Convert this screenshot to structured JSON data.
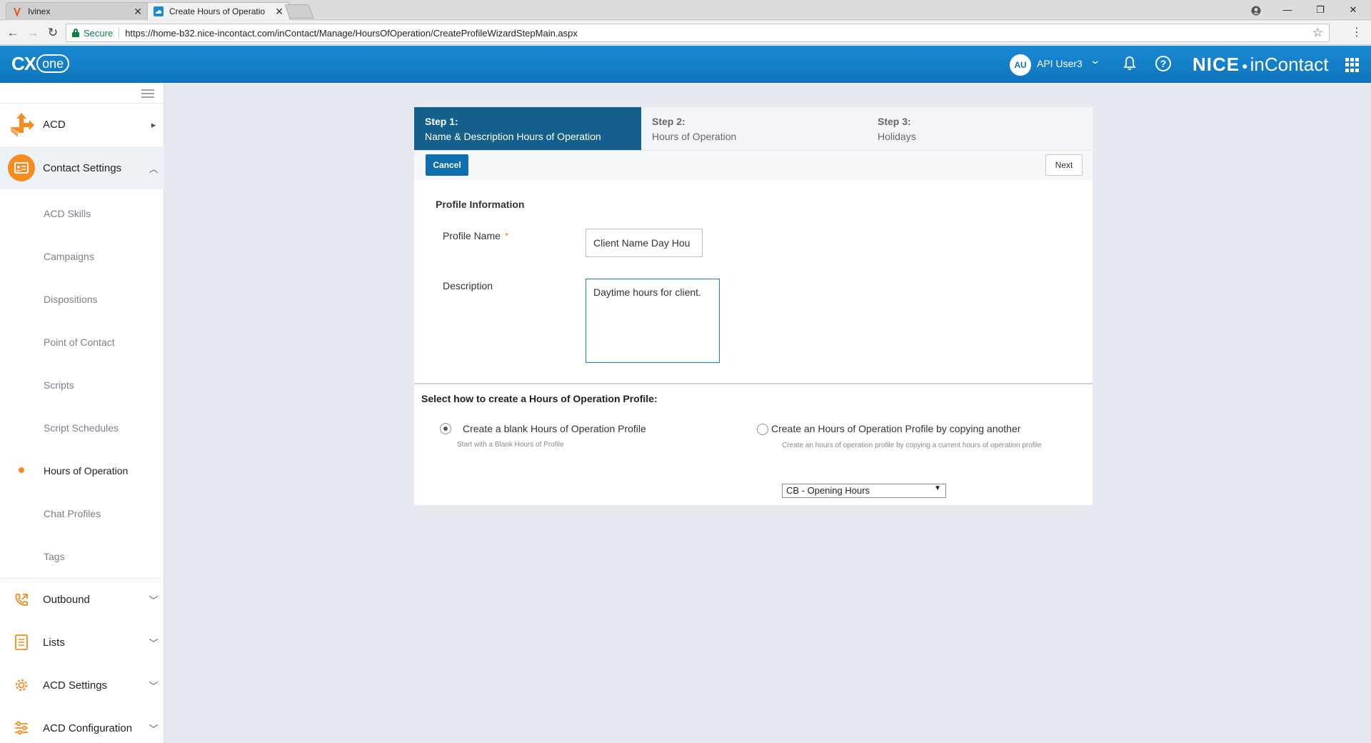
{
  "browser": {
    "tabs": [
      {
        "title": "Ivinex"
      },
      {
        "title": "Create Hours of Operatio"
      }
    ],
    "secure_label": "Secure",
    "url": "https://home-b32.nice-incontact.com/inContact/Manage/HoursOfOperation/CreateProfileWizardStepMain.aspx"
  },
  "header": {
    "logo_cx": "CX",
    "logo_one": "one",
    "user_initials": "AU",
    "user_name": "API User3",
    "brand_nice": "NICE",
    "brand_incontact": "inContact"
  },
  "sidebar": {
    "groups": [
      {
        "label": "ACD",
        "icon": "acd-arrows-icon"
      },
      {
        "label": "Contact Settings",
        "icon": "contact-card-icon"
      },
      {
        "label": "Outbound",
        "icon": "phone-outbound-icon"
      },
      {
        "label": "Lists",
        "icon": "list-icon"
      },
      {
        "label": "ACD Settings",
        "icon": "gear-icon"
      },
      {
        "label": "ACD Configuration",
        "icon": "sliders-icon"
      }
    ],
    "sub_items": [
      "ACD Skills",
      "Campaigns",
      "Dispositions",
      "Point of Contact",
      "Scripts",
      "Script Schedules",
      "Hours of Operation",
      "Chat Profiles",
      "Tags"
    ],
    "current_item": "Hours of Operation"
  },
  "wizard": {
    "steps": [
      {
        "number": "Step 1:",
        "label": "Name & Description Hours of Operation"
      },
      {
        "number": "Step 2:",
        "label": "Hours of Operation"
      },
      {
        "number": "Step 3:",
        "label": "Holidays"
      }
    ],
    "cancel_label": "Cancel",
    "next_label": "Next",
    "profile_section_title": "Profile Information",
    "profile_name_label": "Profile Name",
    "required_mark": "*",
    "profile_name_value": "Client Name Day Hou",
    "description_label": "Description",
    "description_value": "Daytime hours for client.",
    "create_title": "Select how to create a Hours of Operation Profile:",
    "option_blank_label": "Create a blank Hours of Operation Profile",
    "option_blank_help": "Start with a Blank Hours of Profile",
    "option_copy_label": "Create an Hours of Operation Profile by copying another",
    "option_copy_help": "Create an hours of operation profile by copying a current hours of operation profile",
    "copy_select_value": "CB - Opening Hours"
  },
  "colors": {
    "header_blue": "#0e74bd",
    "step_active": "#145f8c",
    "accent_orange": "#f68b1f",
    "button_blue": "#0f6fae"
  }
}
